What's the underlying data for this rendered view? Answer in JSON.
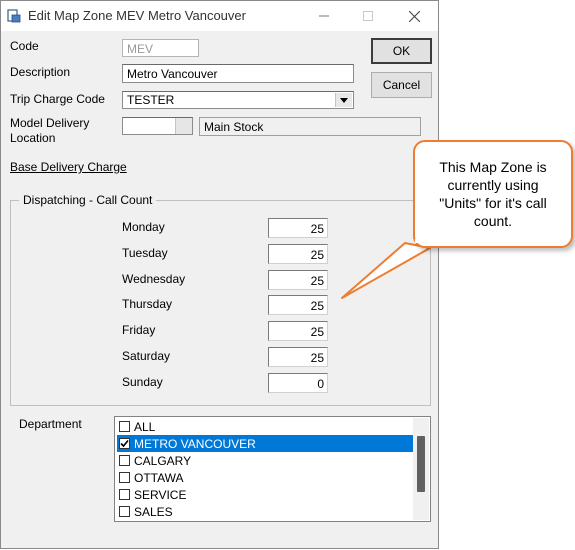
{
  "window": {
    "title": "Edit Map Zone MEV Metro Vancouver",
    "controls": [
      "minimize-icon",
      "maximize-icon",
      "close-icon"
    ]
  },
  "form": {
    "code_label": "Code",
    "code_value": "MEV",
    "description_label": "Description",
    "description_value": "Metro Vancouver",
    "trip_charge_label": "Trip Charge Code",
    "trip_charge_value": "TESTER",
    "model_delivery_label_1": "Model Delivery",
    "model_delivery_label_2": "Location",
    "model_delivery_code": "",
    "model_delivery_name": "Main Stock",
    "base_delivery_link": "Base Delivery Charge"
  },
  "buttons": {
    "ok": "OK",
    "cancel": "Cancel"
  },
  "dispatching": {
    "legend": "Dispatching  -  Call Count",
    "days": [
      {
        "day": "Monday",
        "count": "25"
      },
      {
        "day": "Tuesday",
        "count": "25"
      },
      {
        "day": "Wednesday",
        "count": "25"
      },
      {
        "day": "Thursday",
        "count": "25"
      },
      {
        "day": "Friday",
        "count": "25"
      },
      {
        "day": "Saturday",
        "count": "25"
      },
      {
        "day": "Sunday",
        "count": "0"
      }
    ]
  },
  "department": {
    "label": "Department",
    "items": [
      {
        "name": "ALL",
        "checked": false,
        "selected": false
      },
      {
        "name": "METRO VANCOUVER",
        "checked": true,
        "selected": true
      },
      {
        "name": "CALGARY",
        "checked": false,
        "selected": false
      },
      {
        "name": "OTTAWA",
        "checked": false,
        "selected": false
      },
      {
        "name": "SERVICE",
        "checked": false,
        "selected": false
      },
      {
        "name": "SALES",
        "checked": false,
        "selected": false
      }
    ]
  },
  "callout": {
    "text": "This Map Zone is currently using \"Units\" for it's call count."
  },
  "colors": {
    "selection": "#0078d7",
    "callout_border": "#ed7d31",
    "window_bg": "#f0f0f0"
  }
}
